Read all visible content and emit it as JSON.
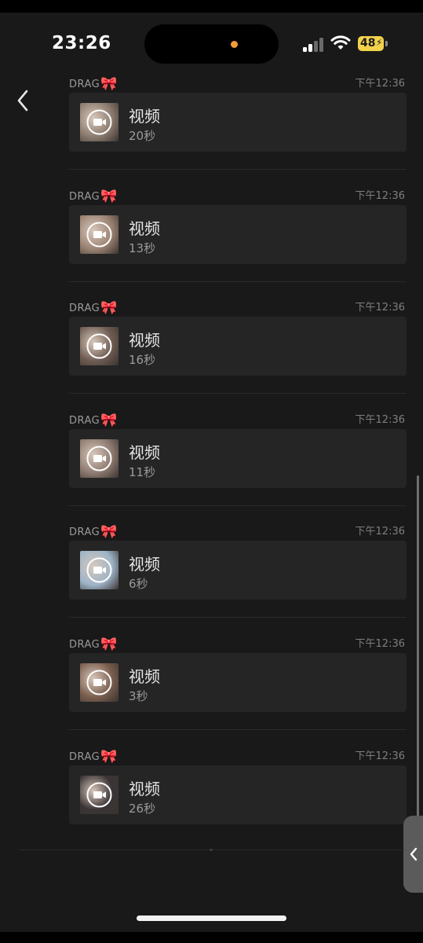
{
  "status_bar": {
    "time": "23:26",
    "battery": "48"
  },
  "nav": {
    "back_icon": "chevron-left-icon",
    "more_icon": "more-dots-icon"
  },
  "messages": [
    {
      "sender": "DRAG",
      "time": "下午12:36",
      "title": "视频",
      "duration": "20秒",
      "thumb_color": "#8a7b6e"
    },
    {
      "sender": "DRAG",
      "time": "下午12:36",
      "title": "视频",
      "duration": "13秒",
      "thumb_color": "#9a8272"
    },
    {
      "sender": "DRAG",
      "time": "下午12:36",
      "title": "视频",
      "duration": "16秒",
      "thumb_color": "#6e5c52"
    },
    {
      "sender": "DRAG",
      "time": "下午12:36",
      "title": "视频",
      "duration": "11秒",
      "thumb_color": "#8d7a70"
    },
    {
      "sender": "DRAG",
      "time": "下午12:36",
      "title": "视频",
      "duration": "6秒",
      "thumb_color": "#9db4c8"
    },
    {
      "sender": "DRAG",
      "time": "下午12:36",
      "title": "视频",
      "duration": "3秒",
      "thumb_color": "#7a5e4e"
    },
    {
      "sender": "DRAG",
      "time": "下午12:36",
      "title": "视频",
      "duration": "26秒",
      "thumb_color": "#3a3436"
    }
  ],
  "colors": {
    "background": "#191919",
    "bubble": "#252525",
    "battery": "#f2d14b",
    "recording_dot": "#f39c39"
  }
}
